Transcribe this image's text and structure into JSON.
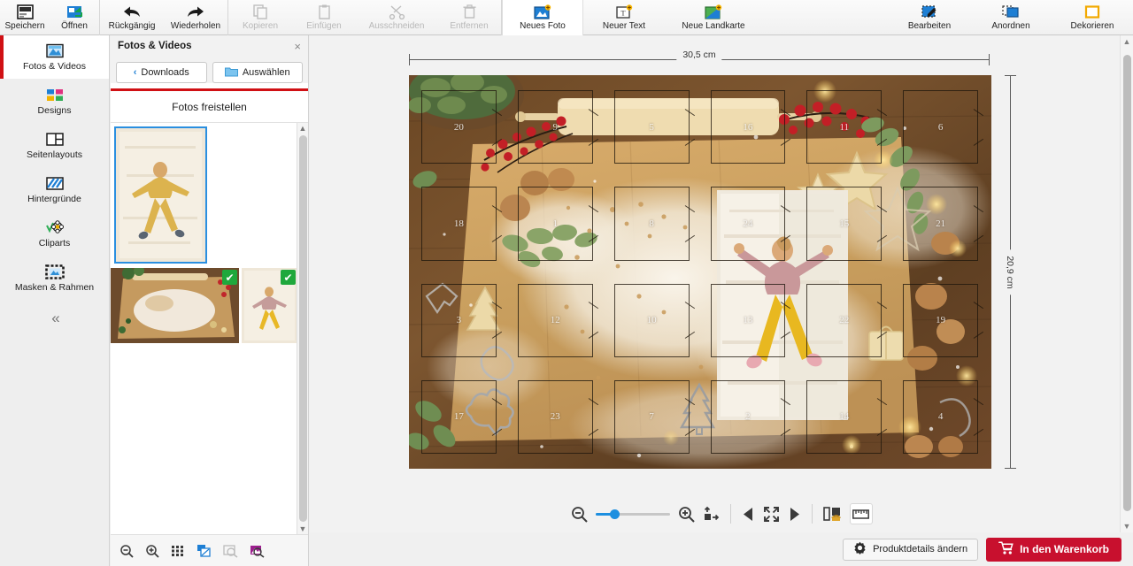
{
  "toolbar": {
    "groups": [
      {
        "items": [
          {
            "label": "Speichern",
            "icon": "save-icon",
            "disabled": false
          },
          {
            "label": "Öffnen",
            "icon": "open-folder-icon",
            "disabled": false
          }
        ]
      },
      {
        "items": [
          {
            "label": "Rückgängig",
            "icon": "undo-arrow-icon",
            "disabled": false
          },
          {
            "label": "Wiederholen",
            "icon": "redo-arrow-icon",
            "disabled": false
          }
        ]
      },
      {
        "items": [
          {
            "label": "Kopieren",
            "icon": "copy-icon",
            "disabled": true
          },
          {
            "label": "Einfügen",
            "icon": "paste-icon",
            "disabled": true
          },
          {
            "label": "Ausschneiden",
            "icon": "scissors-icon",
            "disabled": true
          },
          {
            "label": "Entfernen",
            "icon": "trash-icon",
            "disabled": true
          }
        ]
      },
      {
        "items": [
          {
            "label": "Neues Foto",
            "icon": "new-photo-icon",
            "disabled": false,
            "active": true
          },
          {
            "label": "Neuer Text",
            "icon": "new-text-icon",
            "disabled": false
          },
          {
            "label": "Neue Landkarte",
            "icon": "new-map-icon",
            "disabled": false
          }
        ]
      }
    ],
    "right_items": [
      {
        "label": "Bearbeiten",
        "icon": "edit-pencil-icon"
      },
      {
        "label": "Anordnen",
        "icon": "arrange-icon"
      },
      {
        "label": "Dekorieren",
        "icon": "decorate-frame-icon"
      }
    ]
  },
  "sidebar": {
    "items": [
      {
        "label": "Fotos & Videos",
        "icon": "photos-videos-icon",
        "selected": true
      },
      {
        "label": "Designs",
        "icon": "designs-grid-icon",
        "selected": false
      },
      {
        "label": "Seitenlayouts",
        "icon": "page-layouts-icon",
        "selected": false
      },
      {
        "label": "Hintergründe",
        "icon": "backgrounds-icon",
        "selected": false
      },
      {
        "label": "Cliparts",
        "icon": "cliparts-flower-icon",
        "selected": false
      },
      {
        "label": "Masken & Rahmen",
        "icon": "masks-frames-icon",
        "selected": false
      }
    ],
    "collapse_label": "«"
  },
  "panel": {
    "title": "Fotos & Videos",
    "close_label": "×",
    "source_button": "Downloads",
    "source_chevron": "‹",
    "select_button": "Auswählen",
    "cutout_button": "Fotos freistellen",
    "thumbnails": [
      {
        "name": "child-on-bedsheet-yellow",
        "selected": true,
        "used": false
      },
      {
        "name": "baking-board-flour-flatlay",
        "selected": false,
        "used": true,
        "check": "✔"
      },
      {
        "name": "child-on-bedsheet-small",
        "selected": false,
        "used": true,
        "check": "✔"
      }
    ],
    "footer_icons": [
      {
        "name": "zoom-out-icon",
        "disabled": false
      },
      {
        "name": "zoom-in-icon",
        "disabled": false
      },
      {
        "name": "grid-view-icon",
        "disabled": false
      },
      {
        "name": "layers-icon",
        "disabled": false
      },
      {
        "name": "search-photo-icon",
        "disabled": true
      },
      {
        "name": "find-photo-icon",
        "disabled": false
      }
    ]
  },
  "canvas": {
    "width_label": "30,5 cm",
    "height_label": "20,9 cm",
    "product": "advent-calendar-photo",
    "grid": {
      "columns": 6,
      "rows": 4,
      "door_numbers": [
        [
          20,
          9,
          5,
          16,
          11,
          6
        ],
        [
          18,
          1,
          8,
          24,
          15,
          21
        ],
        [
          3,
          12,
          10,
          13,
          22,
          19
        ],
        [
          17,
          23,
          7,
          2,
          14,
          4
        ]
      ]
    },
    "tools": {
      "zoom_out": "zoom-out-icon",
      "zoom_slider_value": 20,
      "zoom_in": "zoom-in-icon",
      "fit_icon": "fit-to-page-icon",
      "prev_page": "previous-page-icon",
      "fullscreen": "fullscreen-icon",
      "next_page": "next-page-icon",
      "spread_icon": "page-spread-icon",
      "ruler_icon": "ruler-icon"
    }
  },
  "bottombar": {
    "product_details_label": "Produktdetails ändern",
    "product_details_icon": "gear-icon",
    "cart_label": "In den Warenkorb",
    "cart_icon": "shopping-cart-icon",
    "accent_red": "#c8102e"
  }
}
